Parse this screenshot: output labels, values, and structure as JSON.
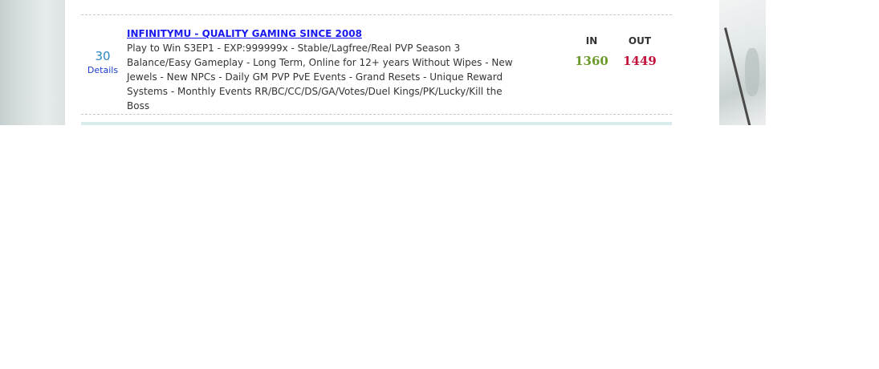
{
  "entry": {
    "rank": "30",
    "details_label": "Details",
    "title": "INFINITYMU - QUALITY GAMING SINCE 2008",
    "description": "Play to Win S3EP1 - EXP:999999x - Stable/Lagfree/Real PVP Season 3 Balance/Easy Gameplay - Long Term, Online for 12+ years Without Wipes - New Jewels - New NPCs - Daily GM PVP PvE Events - Grand Resets - Unique Reward Systems - Monthly Events RR/BC/CC/DS/GA/Votes/Duel Kings/PK/Lucky/Kill the Boss",
    "in_label": "IN",
    "in_value": "1360",
    "out_label": "OUT",
    "out_value": "1449"
  },
  "colors": {
    "rank": "#2e86c1",
    "link": "#1a1aee",
    "in_value": "#6b9a2a",
    "out_value": "#c2133d"
  }
}
